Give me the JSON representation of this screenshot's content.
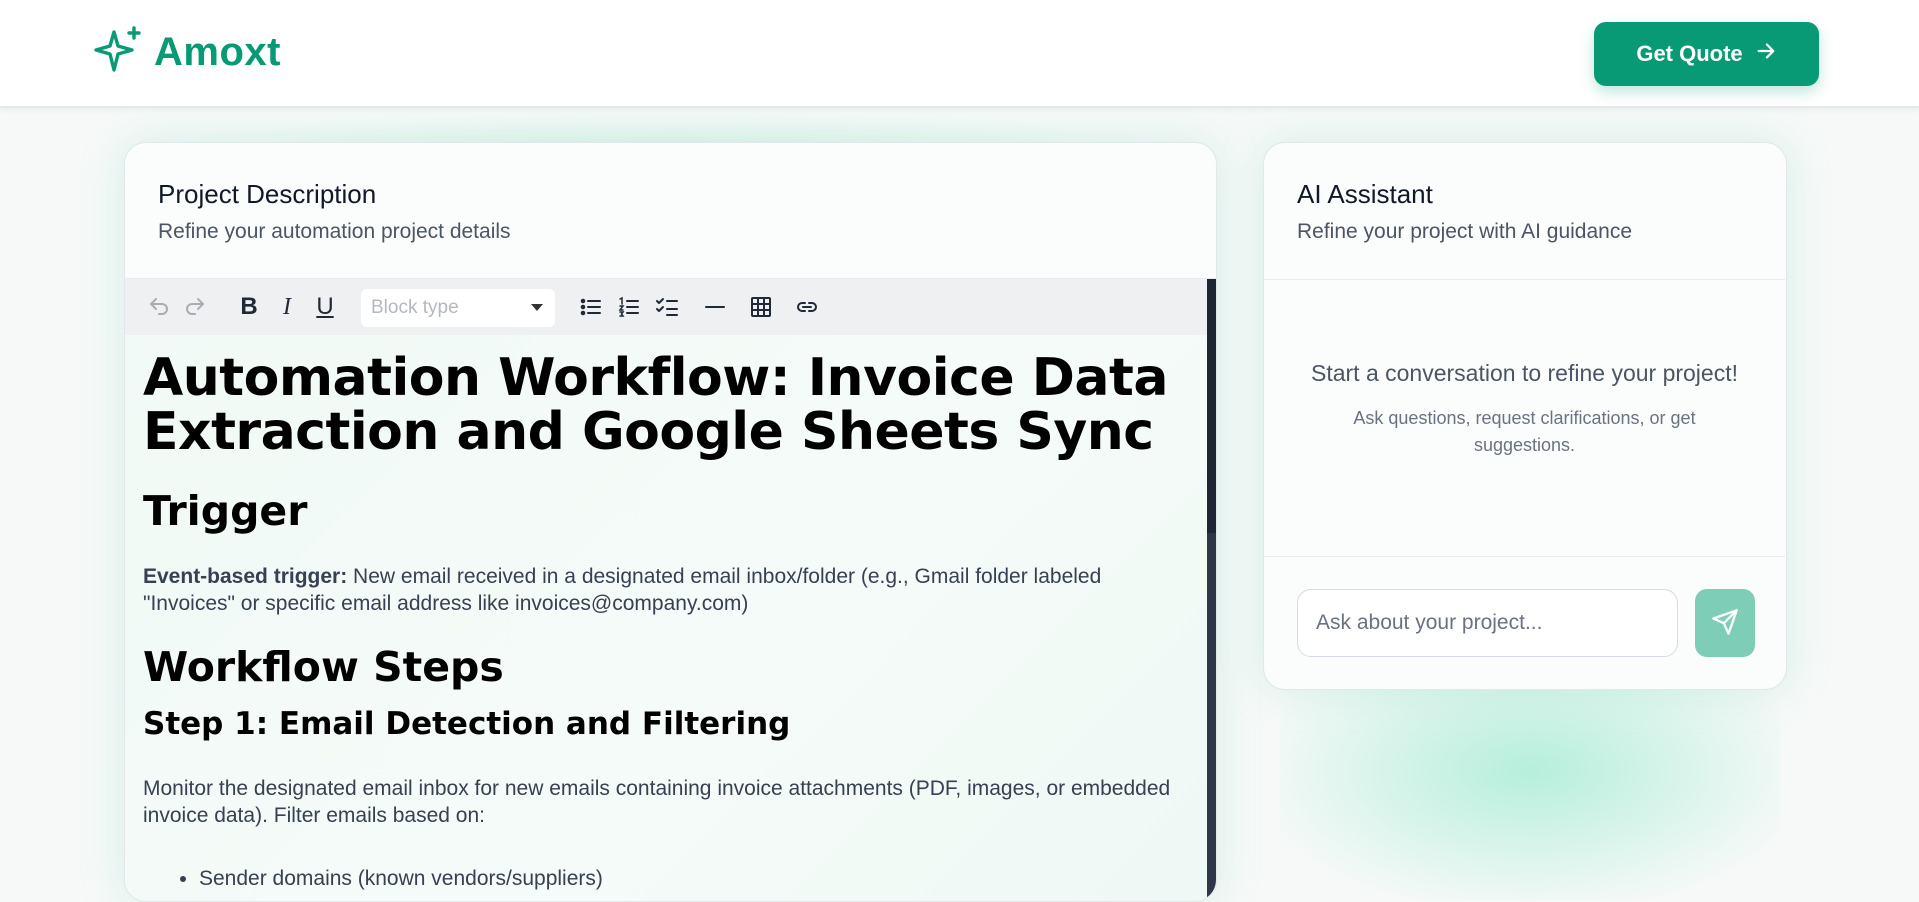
{
  "brand": {
    "name": "Amoxt",
    "accent": "#079a74"
  },
  "header": {
    "cta_label": "Get Quote"
  },
  "project": {
    "title": "Project Description",
    "subtitle": "Refine your automation project details",
    "toolbar": {
      "block_type_placeholder": "Block type",
      "bold": "B",
      "italic": "I",
      "underline": "U"
    },
    "doc": {
      "h1": "Automation Workflow: Invoice Data Extraction and Google Sheets Sync",
      "trigger_heading": "Trigger",
      "trigger_label": "Event-based trigger:",
      "trigger_text": " New email received in a designated email inbox/folder (e.g., Gmail folder labeled \"Invoices\" or specific email address like invoices@company.com)",
      "steps_heading": "Workflow Steps",
      "step1_heading": "Step 1: Email Detection and Filtering",
      "step1_text": "Monitor the designated email inbox for new emails containing invoice attachments (PDF, images, or embedded invoice data). Filter emails based on:",
      "step1_bullets": [
        "Sender domains (known vendors/suppliers)"
      ]
    }
  },
  "assistant": {
    "title": "AI Assistant",
    "subtitle": "Refine your project with AI guidance",
    "empty_title": "Start a conversation to refine your project!",
    "empty_hint": "Ask questions, request clarifications, or get suggestions.",
    "input_placeholder": "Ask about your project..."
  }
}
